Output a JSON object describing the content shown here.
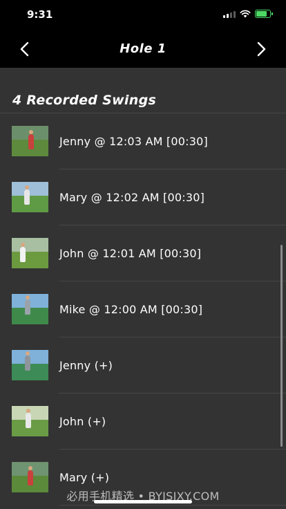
{
  "status_bar": {
    "time": "9:31",
    "signal_bars": 4,
    "signal_active": 2,
    "battery_level": 0.85
  },
  "nav": {
    "back_icon": "chevron-left-icon",
    "forward_icon": "chevron-right-icon",
    "title": "Hole 1"
  },
  "section": {
    "title": "4 Recorded Swings"
  },
  "swings": [
    {
      "label": "Jenny @ 12:03 AM [00:30]",
      "thumb": "golfer-jenny"
    },
    {
      "label": "Mary @ 12:02 AM [00:30]",
      "thumb": "golfer-mary"
    },
    {
      "label": "John @ 12:01 AM [00:30]",
      "thumb": "golfer-john"
    },
    {
      "label": "Mike @ 12:00 AM [00:30]",
      "thumb": "golfer-mike"
    },
    {
      "label": "Jenny (+)",
      "thumb": "golfer-jenny"
    },
    {
      "label": "John (+)",
      "thumb": "golfer-john"
    },
    {
      "label": "Mary (+)",
      "thumb": "golfer-mary"
    }
  ],
  "watermark": "必用手机精选 • BYJSJXY.COM",
  "colors": {
    "background": "#333333",
    "bar": "#000000",
    "separator": "#474747",
    "battery": "#4cd964"
  }
}
